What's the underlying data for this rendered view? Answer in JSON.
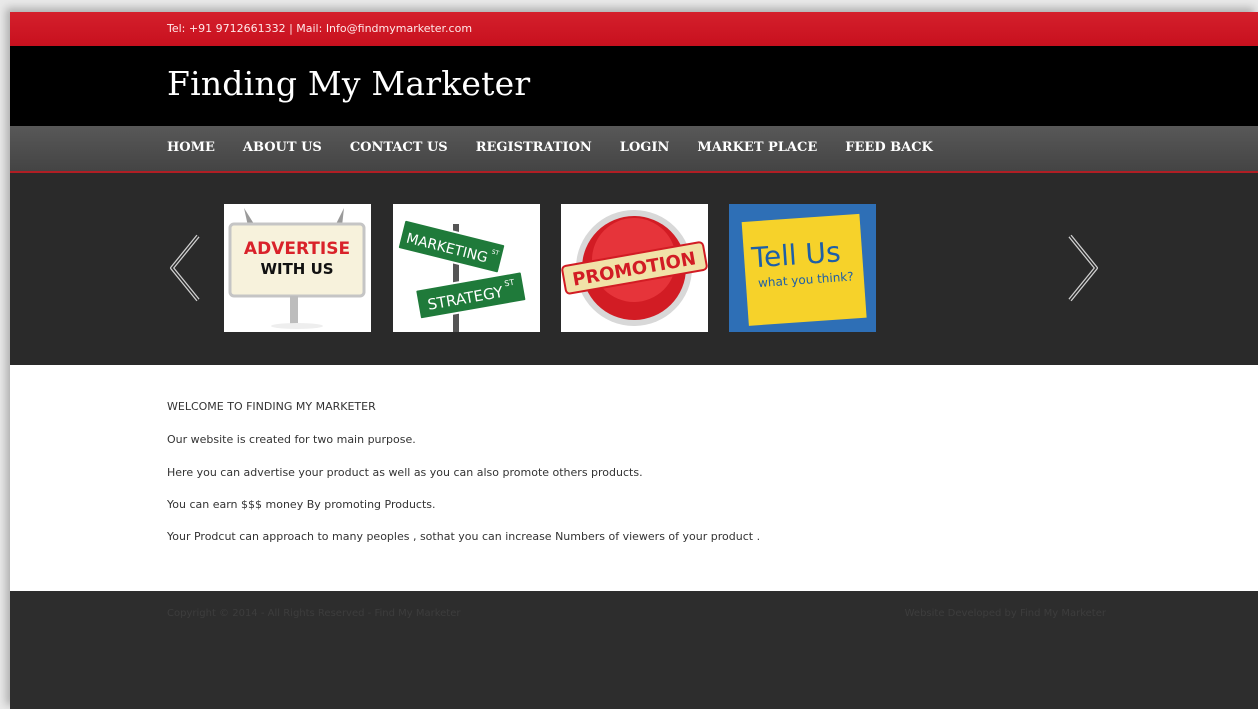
{
  "topbar": {
    "contact": "Tel: +91 9712661332 | Mail: Info@findmymarketer.com"
  },
  "header": {
    "site_title": "Finding My Marketer"
  },
  "nav": {
    "items": [
      "HOME",
      "ABOUT US",
      "CONTACT US",
      "REGISTRATION",
      "LOGIN",
      "MARKET PLACE",
      "FEED BACK"
    ]
  },
  "slider": {
    "prev_icon": "chevron-left-icon",
    "next_icon": "chevron-right-icon",
    "slides": [
      {
        "line1": "ADVERTISE",
        "line2": "WITH US"
      },
      {
        "line1": "MARKETING",
        "line1_sup": "ST",
        "line2": "STRATEGY",
        "line2_sup": "ST"
      },
      {
        "line1": "PROMOTION"
      },
      {
        "line1": "Tell Us",
        "line2": "what you think?"
      }
    ]
  },
  "content": {
    "heading": "WELCOME TO FINDING MY MARKETER",
    "paragraphs": [
      "Our website is created for two main purpose.",
      "Here you can advertise your product as well as you can also promote others products.",
      "You can earn $$$ money By promoting Products.",
      "Your Prodcut can approach to many peoples , sothat you can increase Numbers of viewers of your product ."
    ]
  },
  "footer": {
    "copyright": "Copyright © 2014 - All Rights Reserved - Find My Marketer",
    "developer": "Website Developed by Find My Marketer"
  },
  "colors": {
    "topbar_red": "#cc1622",
    "header_black": "#000000",
    "nav_gray": "#4e4e4e",
    "slider_dark": "#2a2a2a",
    "footer_dark": "#2d2d2d"
  }
}
